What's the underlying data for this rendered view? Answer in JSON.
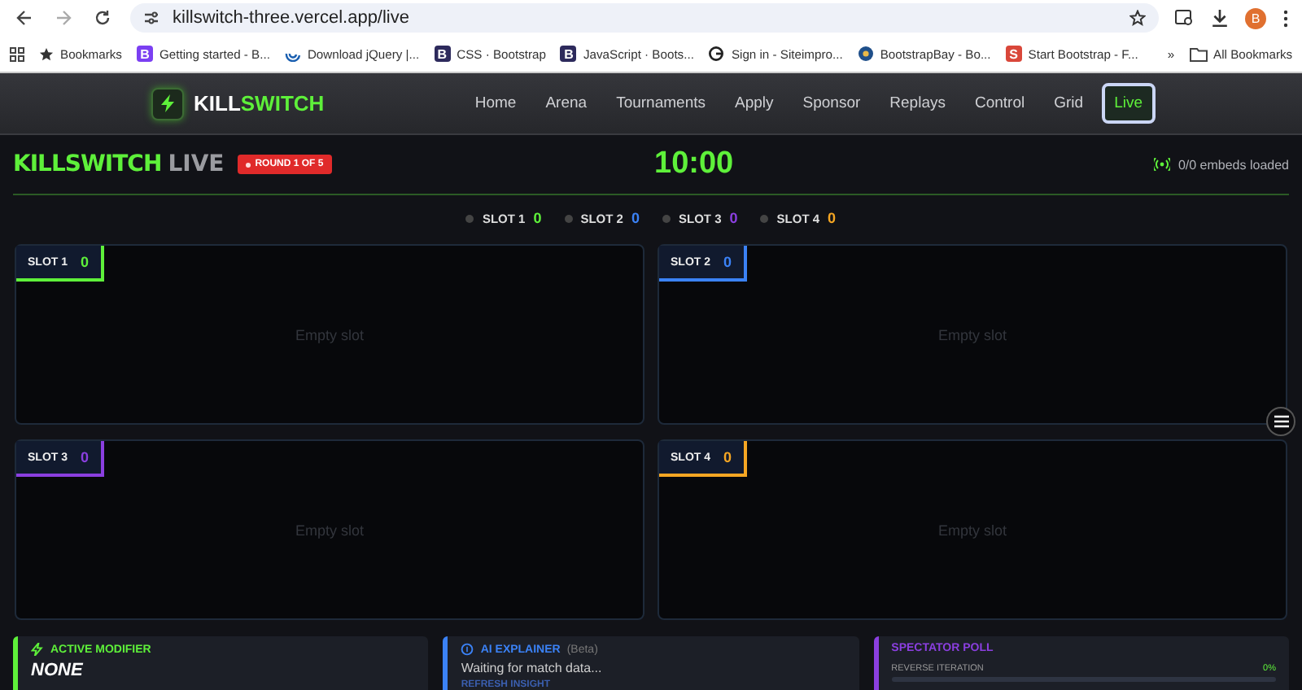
{
  "browser": {
    "url": "killswitch-three.vercel.app/live",
    "profile_initial": "B",
    "bookmarks": [
      {
        "kind": "star",
        "label": "Bookmarks"
      },
      {
        "kind": "letter",
        "badge": "B",
        "color": "#7b3ff2",
        "label": "Getting started - B..."
      },
      {
        "kind": "swirl",
        "label": "Download jQuery |..."
      },
      {
        "kind": "letter",
        "badge": "B",
        "color": "#2d2a5c",
        "label": "CSS · Bootstrap"
      },
      {
        "kind": "letter",
        "badge": "B",
        "color": "#2d2a5c",
        "label": "JavaScript · Boots..."
      },
      {
        "kind": "ring",
        "label": "Sign in - Siteimpro..."
      },
      {
        "kind": "globe",
        "label": "BootstrapBay - Bo..."
      },
      {
        "kind": "letter",
        "badge": "S",
        "color": "#d9473a",
        "label": "Start Bootstrap - F..."
      }
    ],
    "more": "»",
    "all_bookmarks": "All Bookmarks"
  },
  "nav": {
    "brand_parts": [
      "KILL",
      "SWITCH"
    ],
    "items": [
      {
        "label": "Home",
        "selected": false
      },
      {
        "label": "Arena",
        "selected": false
      },
      {
        "label": "Tournaments",
        "selected": false
      },
      {
        "label": "Apply",
        "selected": false
      },
      {
        "label": "Sponsor",
        "selected": false
      },
      {
        "label": "Replays",
        "selected": false
      },
      {
        "label": "Control",
        "selected": false
      },
      {
        "label": "Grid",
        "selected": false
      },
      {
        "label": "Live",
        "selected": true
      }
    ]
  },
  "header": {
    "title": "KILLSWITCH",
    "title_suffix": "LIVE",
    "round_badge": "ROUND 1 OF 5",
    "timer": "10:00",
    "embeds_status": "0/0 embeds loaded"
  },
  "legend": [
    {
      "label": "SLOT 1",
      "score": "0",
      "color": "#5ef03a"
    },
    {
      "label": "SLOT 2",
      "score": "0",
      "color": "#3b82f6"
    },
    {
      "label": "SLOT 3",
      "score": "0",
      "color": "#8b3fe0"
    },
    {
      "label": "SLOT 4",
      "score": "0",
      "color": "#f5a623"
    }
  ],
  "slots": [
    {
      "label": "SLOT 1",
      "score": "0",
      "color": "#5ef03a",
      "placeholder": "Empty slot"
    },
    {
      "label": "SLOT 2",
      "score": "0",
      "color": "#3b82f6",
      "placeholder": "Empty slot"
    },
    {
      "label": "SLOT 3",
      "score": "0",
      "color": "#8b3fe0",
      "placeholder": "Empty slot"
    },
    {
      "label": "SLOT 4",
      "score": "0",
      "color": "#f5a623",
      "placeholder": "Empty slot"
    }
  ],
  "cards": [
    {
      "kind": "modifier",
      "color": "#5ef03a",
      "title": "ACTIVE MODIFIER",
      "value": "NONE"
    },
    {
      "kind": "explainer",
      "color": "#3b82f6",
      "title": "AI EXPLAINER",
      "tag": "(Beta)",
      "text": "Waiting for match data...",
      "action": "REFRESH INSIGHT"
    },
    {
      "kind": "poll",
      "color": "#8b3fe0",
      "title": "SPECTATOR POLL",
      "option": "REVERSE ITERATION",
      "percent": "0%",
      "level": 0
    }
  ]
}
